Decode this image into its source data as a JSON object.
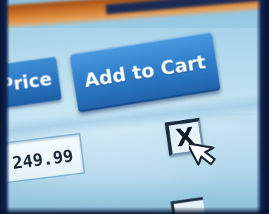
{
  "form": {
    "price_button_label": "Price",
    "add_to_cart_label": "Add to Cart",
    "price_value": "249.99",
    "checkbox_mark": "X"
  },
  "colors": {
    "button_blue": "#2f7dc9",
    "top_bar_orange": "#d07a2c",
    "screen_background": "#a9d4ea"
  },
  "icons": {
    "cursor": "arrow-cursor-icon",
    "checkbox": "checked-box-icon"
  }
}
